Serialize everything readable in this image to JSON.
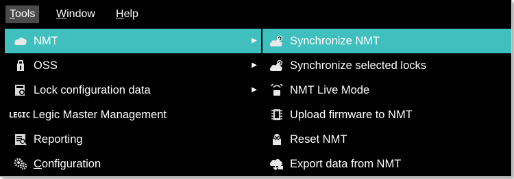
{
  "menubar": {
    "items": [
      {
        "label_first": "T",
        "label_rest": "ools"
      },
      {
        "label_first": "W",
        "label_rest": "indow"
      },
      {
        "label_first": "H",
        "label_rest": "elp"
      }
    ]
  },
  "tools_menu": {
    "items": [
      {
        "label": "NMT",
        "icon": "cloud-icon",
        "has_submenu": true,
        "highlighted": true
      },
      {
        "label": "OSS",
        "icon": "lock-cylinder-icon",
        "has_submenu": true
      },
      {
        "label": "Lock configuration data",
        "icon": "config-data-icon",
        "has_submenu": true
      },
      {
        "label": "Legic Master Management",
        "icon": "legic-logo-icon",
        "logo_text": "LEGIC"
      },
      {
        "label": "Reporting",
        "icon": "report-icon"
      },
      {
        "label_first": "C",
        "label_rest": "onfiguration",
        "icon": "gears-icon"
      }
    ]
  },
  "nmt_submenu": {
    "items": [
      {
        "label": "Synchronize NMT",
        "icon": "sync-cloud-icon",
        "highlighted": true
      },
      {
        "label": "Synchronize selected locks",
        "icon": "sync-locks-icon"
      },
      {
        "label": "NMT Live Mode",
        "icon": "live-mode-icon"
      },
      {
        "label": "Upload firmware to NMT",
        "icon": "firmware-icon"
      },
      {
        "label": "Reset NMT",
        "icon": "reset-icon"
      },
      {
        "label": "Export data from NMT",
        "icon": "export-icon"
      }
    ]
  },
  "colors": {
    "background": "#000000",
    "highlight": "#40bfbf",
    "menubar_active": "#4a4a4a",
    "text": "#ffffff"
  }
}
